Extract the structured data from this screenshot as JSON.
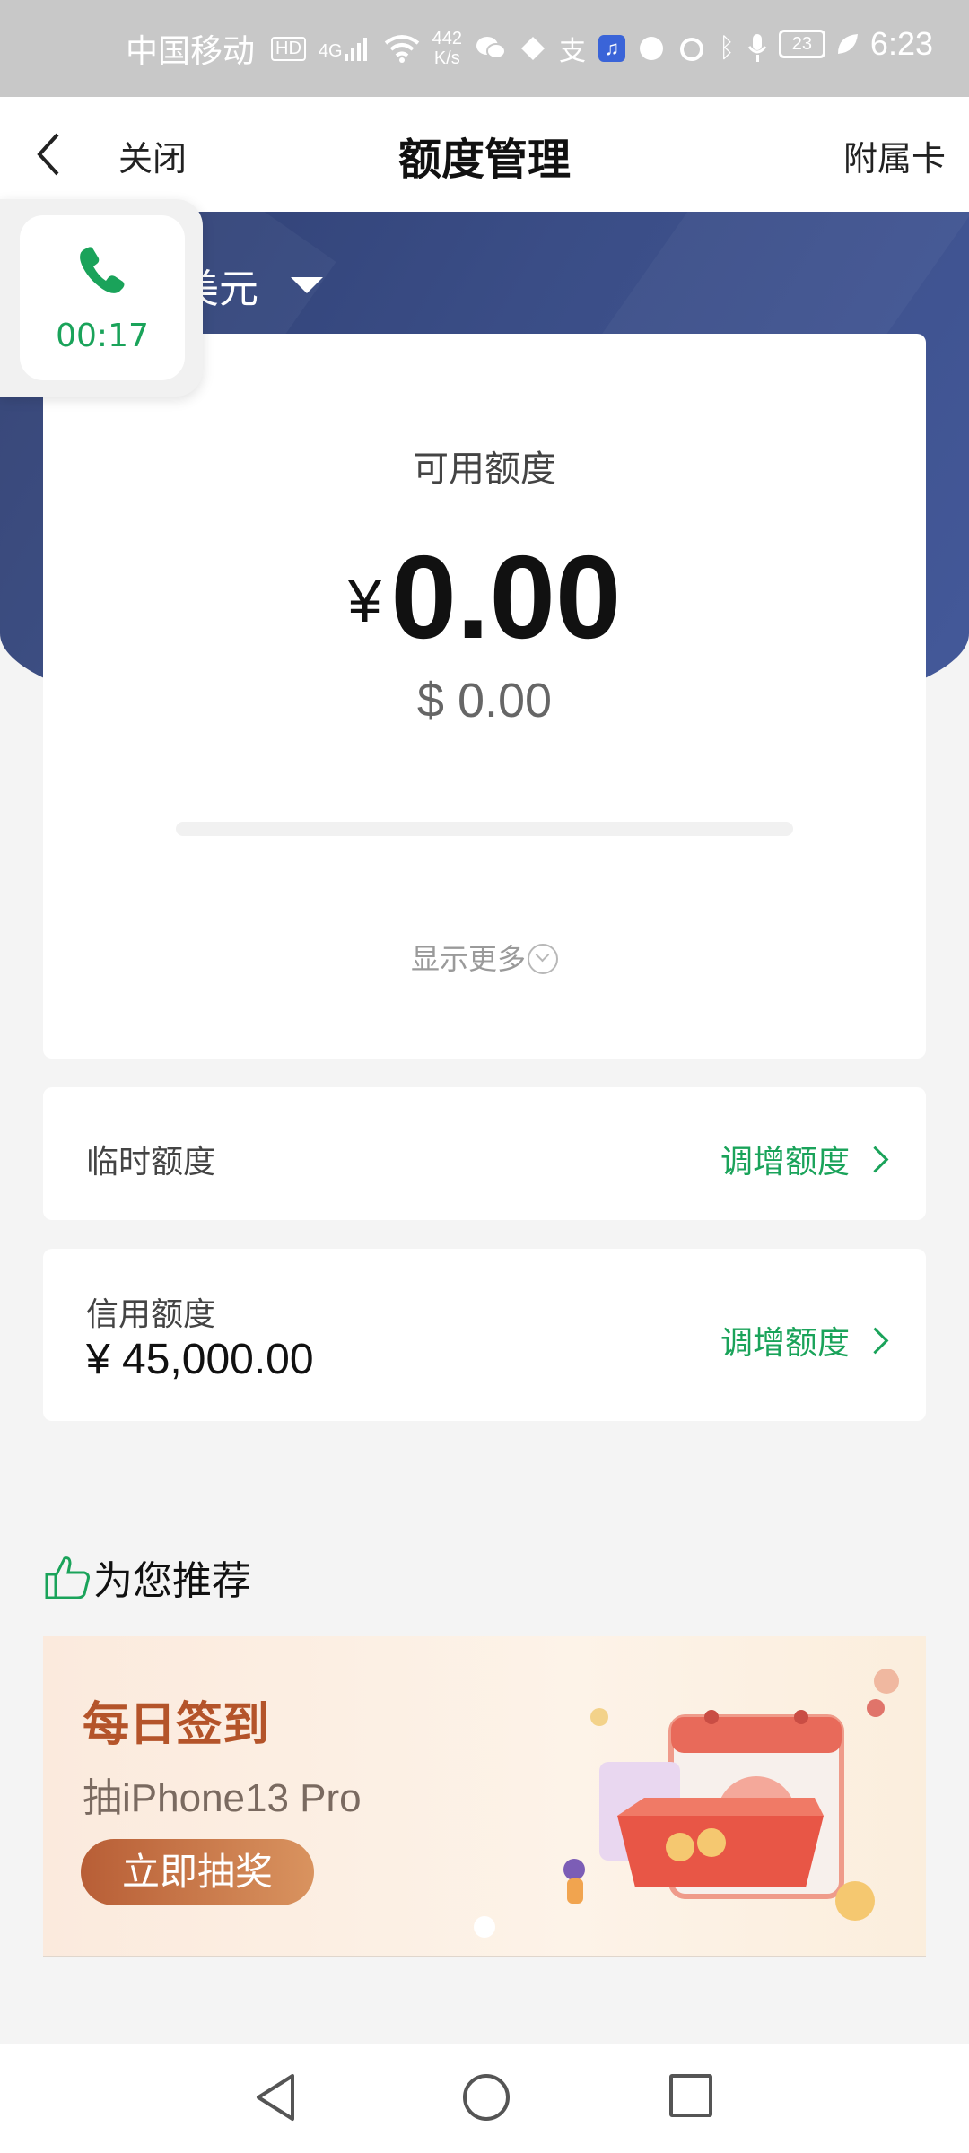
{
  "status_bar": {
    "carrier": "中国移动",
    "hd_badge": "HD",
    "network_type": "4G",
    "speed_value": "442",
    "speed_unit": "K/s",
    "battery": "23",
    "time": "6:23",
    "icons": [
      "hd-icon",
      "signal-icon",
      "wifi-icon",
      "wechat-icon",
      "app-icon",
      "alipay-icon",
      "music-icon",
      "app2-icon",
      "alarm-icon",
      "bluetooth-icon",
      "mic-icon",
      "battery-icon",
      "leaf-icon"
    ]
  },
  "nav": {
    "close_label": "关闭",
    "title": "额度管理",
    "right_label": "附属卡"
  },
  "call": {
    "time": "00:17"
  },
  "currency": {
    "selected": "美元"
  },
  "available": {
    "label": "可用额度",
    "symbol": "¥",
    "amount": "0.00",
    "usd": "$ 0.00",
    "used_fraction": 0,
    "show_more": "显示更多"
  },
  "temp_limit": {
    "label": "临时额度",
    "action": "调增额度"
  },
  "credit_limit": {
    "label": "信用额度",
    "amount": "¥ 45,000.00",
    "action": "调增额度"
  },
  "recommend": {
    "title": "为您推荐",
    "banner": {
      "title": "每日签到",
      "subtitle": "抽iPhone13 Pro",
      "button": "立即抽奖"
    }
  },
  "colors": {
    "accent_green": "#1aa35a",
    "hero_blue": "#3a4d86",
    "banner_brown": "#b4542a"
  }
}
